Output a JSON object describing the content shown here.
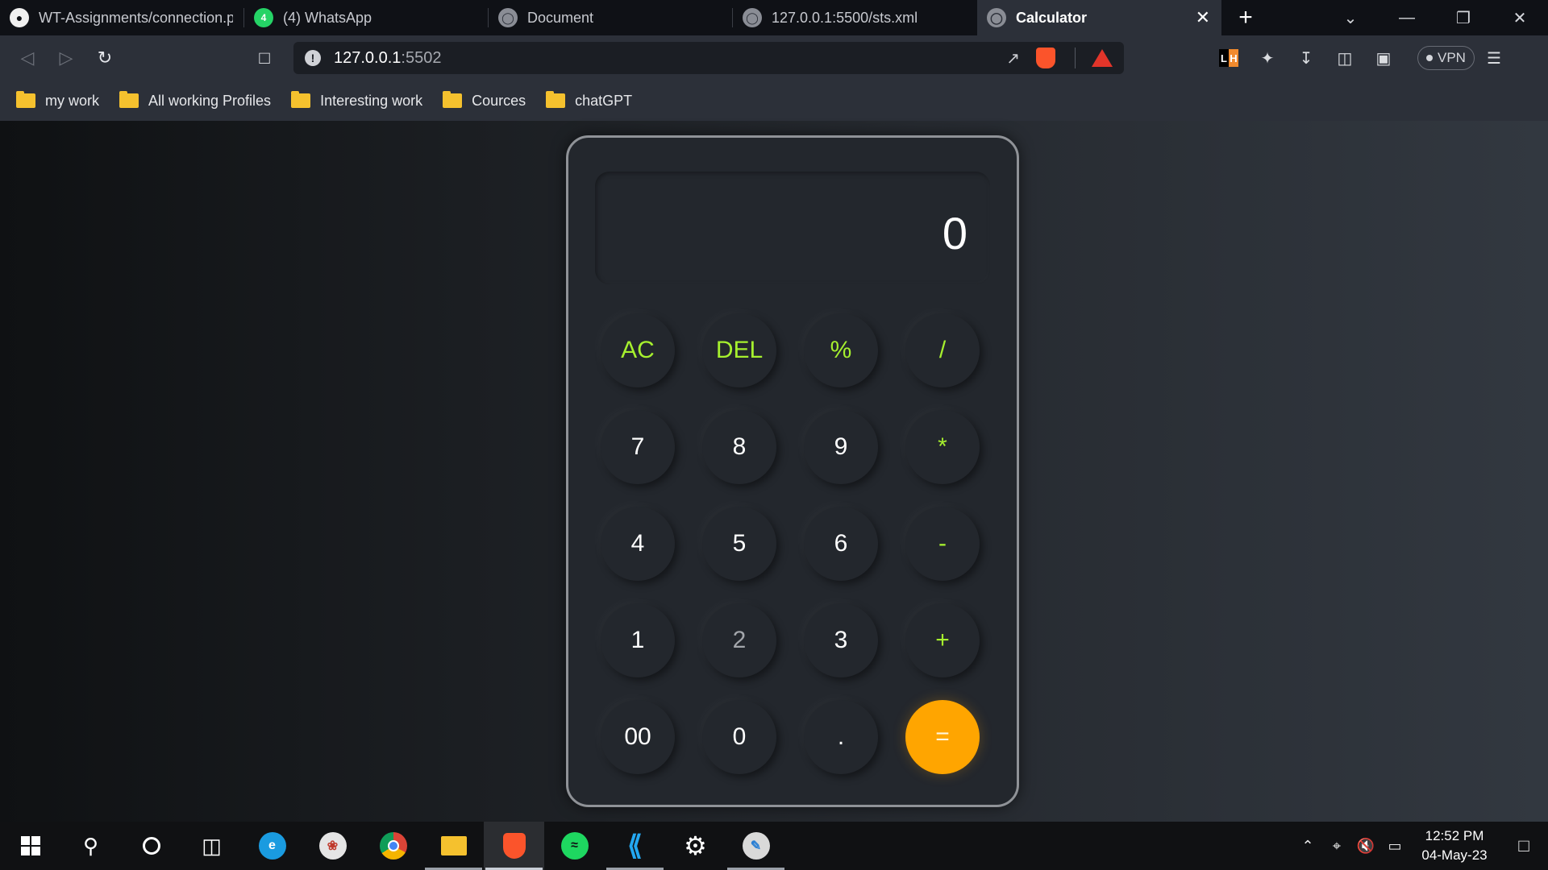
{
  "browser": {
    "tabs": [
      {
        "label": "WT-Assignments/connection.p",
        "icon": "github-icon"
      },
      {
        "label": "(4) WhatsApp",
        "icon": "whatsapp-icon",
        "badge": "4"
      },
      {
        "label": "Document",
        "icon": "globe-icon"
      },
      {
        "label": "127.0.0.1:5500/sts.xml",
        "icon": "globe-icon"
      },
      {
        "label": "Calculator",
        "icon": "globe-icon",
        "active": true
      }
    ],
    "url_host": "127.0.0.1",
    "url_port": ":5502",
    "vpn_label": "VPN",
    "extension_badge": {
      "left": "L",
      "right": "H"
    },
    "bookmarks": [
      "my work",
      "All working Profiles",
      "Interesting work",
      "Cources",
      "chatGPT"
    ]
  },
  "calculator": {
    "display": "0",
    "keys": {
      "ac": "AC",
      "del": "DEL",
      "percent": "%",
      "divide": "/",
      "seven": "7",
      "eight": "8",
      "nine": "9",
      "multiply": "*",
      "four": "4",
      "five": "5",
      "six": "6",
      "minus": "-",
      "one": "1",
      "two": "2",
      "three": "3",
      "plus": "+",
      "double_zero": "00",
      "zero": "0",
      "decimal": ".",
      "equals": "="
    },
    "colors": {
      "operator": "#a6f02e",
      "equals": "#ffa500",
      "digit": "#ffffff"
    }
  },
  "taskbar": {
    "time": "12:52 PM",
    "date": "04-May-23"
  }
}
